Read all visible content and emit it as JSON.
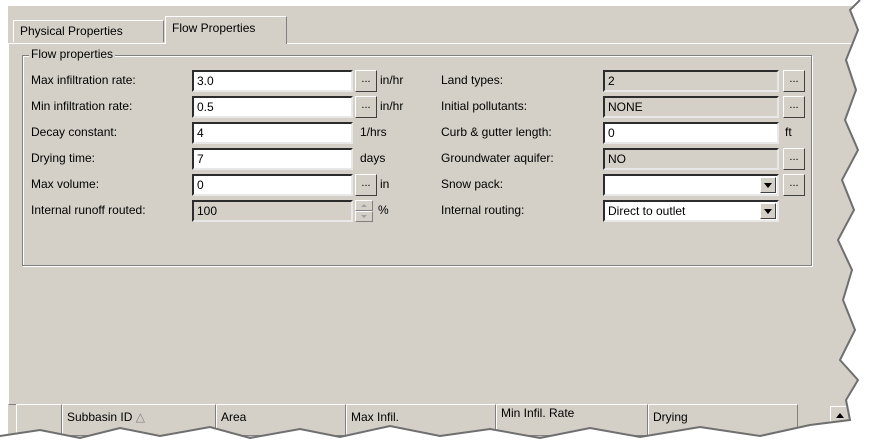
{
  "tabs": [
    {
      "label": "Physical Properties",
      "active": false
    },
    {
      "label": "Flow Properties",
      "active": true
    }
  ],
  "group_title": "Flow properties",
  "left_fields": [
    {
      "label": "Max infiltration rate:",
      "value": "3.0",
      "unit": "in/hr",
      "button": "..."
    },
    {
      "label": "Min infiltration rate:",
      "value": "0.5",
      "unit": "in/hr",
      "button": "..."
    },
    {
      "label": "Decay constant:",
      "value": "4",
      "unit": "1/hrs"
    },
    {
      "label": "Drying time:",
      "value": "7",
      "unit": "days"
    },
    {
      "label": "Max volume:",
      "value": "0",
      "unit": "in",
      "button": "..."
    },
    {
      "label": "Internal runoff routed:",
      "value": "100",
      "unit": "%"
    }
  ],
  "right_fields": [
    {
      "label": "Land types:",
      "value": "2",
      "button": "..."
    },
    {
      "label": "Initial pollutants:",
      "value": "NONE",
      "button": "..."
    },
    {
      "label": "Curb & gutter length:",
      "value": "0",
      "unit": "ft"
    },
    {
      "label": "Groundwater aquifer:",
      "value": "NO",
      "button": "..."
    },
    {
      "label": "Snow pack:",
      "value": "",
      "button": "..."
    },
    {
      "label": "Internal routing:",
      "value": "Direct to outlet"
    }
  ],
  "grid_columns": [
    "",
    "Subbasin ID",
    "Area",
    "Max Infil.",
    "Min Infil. Rate",
    "Drying"
  ],
  "colors": {
    "face": "#d4d0c8",
    "shadow": "#808080",
    "highlight": "#ffffff"
  }
}
